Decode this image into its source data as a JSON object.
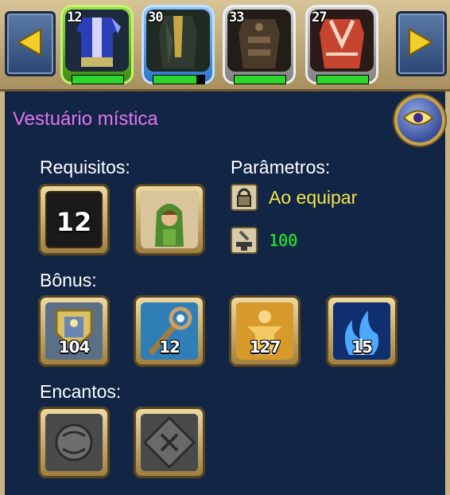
{
  "carousel": {
    "slots": [
      {
        "level": "12",
        "icon": "blue-mystic-robe-icon",
        "durability": 1.0
      },
      {
        "level": "30",
        "icon": "dark-robe-icon",
        "durability": 0.85
      },
      {
        "level": "33",
        "icon": "leather-armor-icon",
        "durability": 1.0
      },
      {
        "level": "27",
        "icon": "red-robe-icon",
        "durability": 1.0
      }
    ]
  },
  "item": {
    "name": "Vestuário mística"
  },
  "sections": {
    "requirements": "Requisitos:",
    "parameters": "Parâmetros:",
    "bonus": "Bônus:",
    "enchants": "Encantos:"
  },
  "requirements": {
    "level": "12",
    "class_icon": "hooded-character-icon"
  },
  "parameters": {
    "binding": "Ao equipar",
    "durability": "100"
  },
  "bonuses": [
    {
      "icon": "shield-defense-icon",
      "value": "104"
    },
    {
      "icon": "magic-staff-icon",
      "value": "12"
    },
    {
      "icon": "golden-figure-icon",
      "value": "127"
    },
    {
      "icon": "blue-flames-icon",
      "value": "15"
    }
  ],
  "enchants": [
    {
      "icon": "empty-enchant-slot-icon"
    },
    {
      "icon": "empty-rune-slot-icon"
    }
  ],
  "colors": {
    "title": "#e774ef",
    "binding": "#f5e64a",
    "durability": "#2fe82f",
    "panel": "#102444",
    "frame": "#c9b284"
  }
}
